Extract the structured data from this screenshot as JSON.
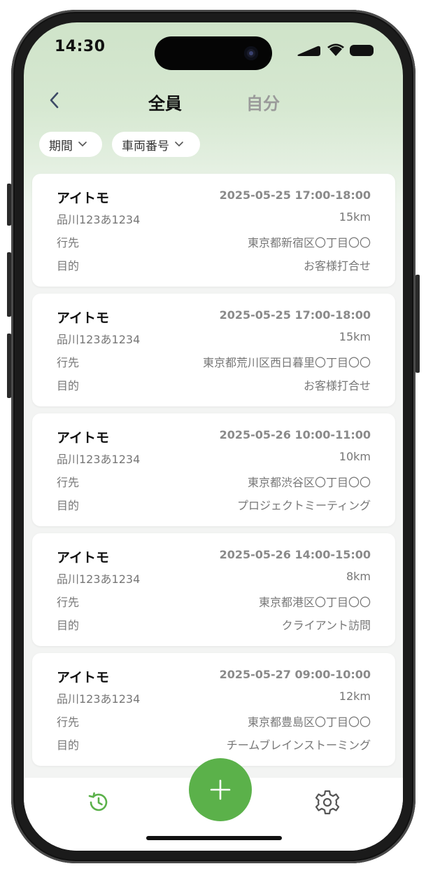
{
  "status_bar": {
    "time": "14:30"
  },
  "header": {
    "tabs": [
      {
        "label": "全員",
        "active": true
      },
      {
        "label": "自分",
        "active": false
      }
    ]
  },
  "filters": [
    {
      "label": "期間"
    },
    {
      "label": "車両番号"
    }
  ],
  "row_labels": {
    "destination": "行先",
    "purpose": "目的"
  },
  "records": [
    {
      "name": "アイトモ",
      "datetime": "2025-05-25 17:00-18:00",
      "plate": "品川123あ1234",
      "distance": "15km",
      "destination": "東京都新宿区〇丁目〇〇",
      "purpose": "お客様打合せ"
    },
    {
      "name": "アイトモ",
      "datetime": "2025-05-25 17:00-18:00",
      "plate": "品川123あ1234",
      "distance": "15km",
      "destination": "東京都荒川区西日暮里〇丁目〇〇",
      "purpose": "お客様打合せ"
    },
    {
      "name": "アイトモ",
      "datetime": "2025-05-26 10:00-11:00",
      "plate": "品川123あ1234",
      "distance": "10km",
      "destination": "東京都渋谷区〇丁目〇〇",
      "purpose": "プロジェクトミーティング"
    },
    {
      "name": "アイトモ",
      "datetime": "2025-05-26 14:00-15:00",
      "plate": "品川123あ1234",
      "distance": "8km",
      "destination": "東京都港区〇丁目〇〇",
      "purpose": "クライアント訪問"
    },
    {
      "name": "アイトモ",
      "datetime": "2025-05-27 09:00-10:00",
      "plate": "品川123あ1234",
      "distance": "12km",
      "destination": "東京都豊島区〇丁目〇〇",
      "purpose": "チームブレインストーミング"
    }
  ],
  "bottom_nav": {
    "items": [
      {
        "icon": "history-icon",
        "active": true
      },
      {
        "icon": "plus-icon"
      },
      {
        "icon": "gear-icon"
      }
    ]
  },
  "colors": {
    "accent": "#5bb14a",
    "header_tint": "#cfe3c9",
    "inactive_tab": "#9a9a9a",
    "muted_text": "#777777"
  }
}
